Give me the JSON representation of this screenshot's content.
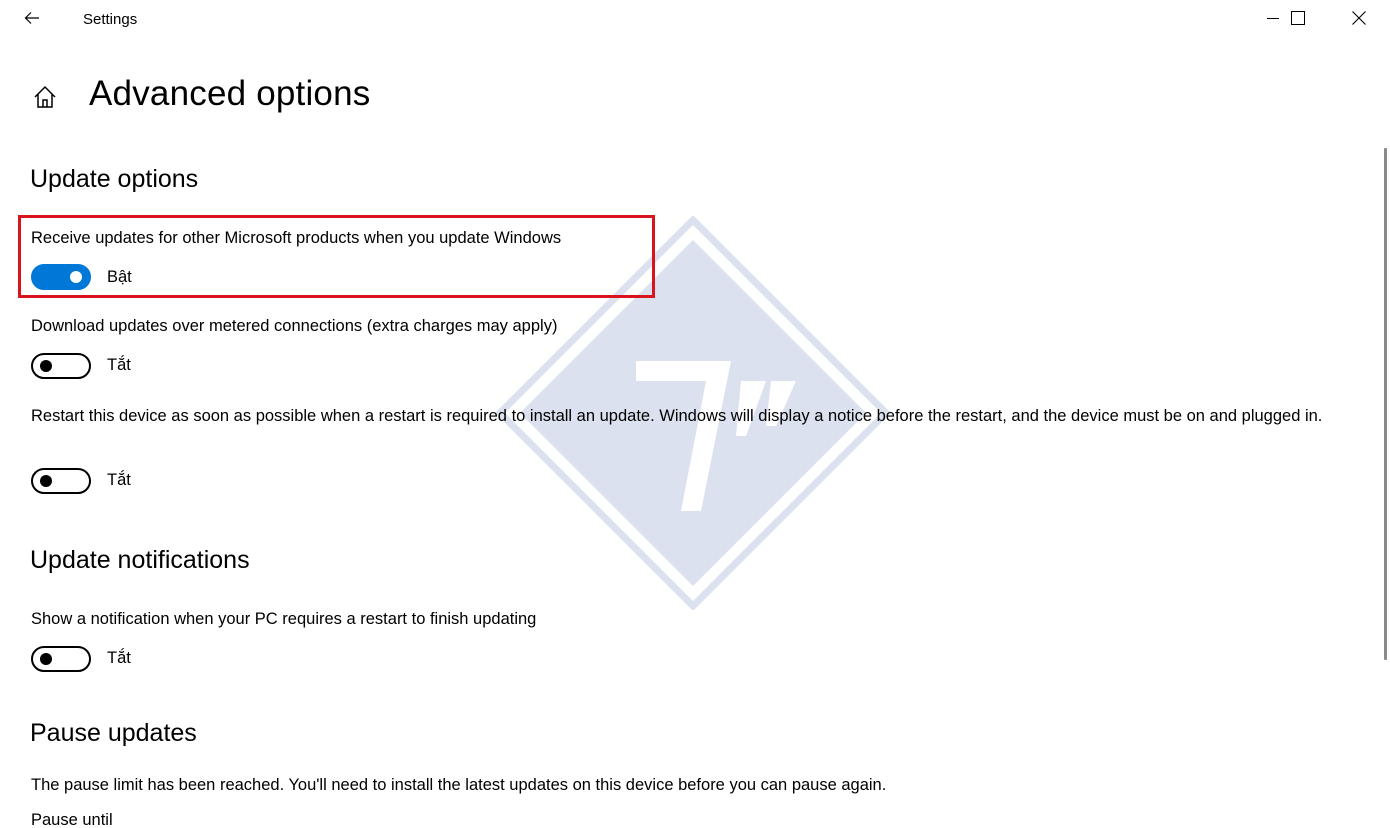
{
  "titlebar": {
    "title": "Settings",
    "back_icon": "arrow-left-icon",
    "minimize_icon": "minimize-icon",
    "maximize_icon": "maximize-icon",
    "close_icon": "close-icon"
  },
  "header": {
    "home_icon": "home-icon",
    "title": "Advanced options"
  },
  "sections": {
    "update_options": {
      "title": "Update options",
      "settings": [
        {
          "label": "Receive updates for other Microsoft products when you update Windows",
          "state": "Bật",
          "on": true
        },
        {
          "label": "Download updates over metered connections (extra charges may apply)",
          "state": "Tắt",
          "on": false
        },
        {
          "label": "Restart this device as soon as possible when a restart is required to install an update. Windows will display a notice before the restart, and the device must be on and plugged in.",
          "state": "Tắt",
          "on": false
        }
      ]
    },
    "update_notifications": {
      "title": "Update notifications",
      "settings": [
        {
          "label": "Show a notification when your PC requires a restart to finish updating",
          "state": "Tắt",
          "on": false
        }
      ]
    },
    "pause_updates": {
      "title": "Pause updates",
      "message": "The pause limit has been reached. You'll need to install the latest updates on this device before you can pause again.",
      "pause_until_label": "Pause until"
    }
  },
  "colors": {
    "accent": "#0078d7",
    "highlight": "#d9141c",
    "watermark": "#dbe1ee"
  },
  "watermark_icon": "diamond-logo-watermark"
}
